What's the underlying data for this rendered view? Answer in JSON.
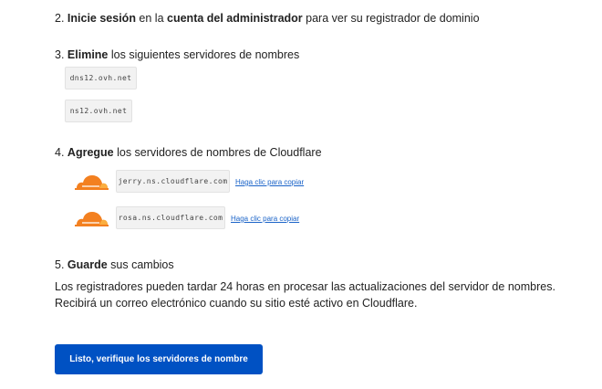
{
  "step2": {
    "num": "2.",
    "bold1": "Inicie sesión",
    "text1": " en la ",
    "bold2": "cuenta del administrador",
    "text2": " para ver su registrador de dominio"
  },
  "step3": {
    "num": "3.",
    "bold": "Elimine",
    "text": " los siguientes servidores de nombres",
    "nameservers": [
      "dns12.ovh.net",
      "ns12.ovh.net"
    ]
  },
  "step4": {
    "num": "4.",
    "bold": "Agregue",
    "text": " los servidores de nombres de Cloudflare",
    "nameservers": [
      {
        "value": "jerry.ns.cloudflare.com",
        "copy_label": "Haga clic para copiar"
      },
      {
        "value": "rosa.ns.cloudflare.com",
        "copy_label": "Haga clic para copiar"
      }
    ]
  },
  "step5": {
    "num": "5.",
    "bold": "Guarde",
    "text": " sus cambios",
    "note": "Los registradores pueden tardar 24 horas en procesar las actualizaciones del servidor de nombres. Recibirá un correo electrónico cuando su sitio esté activo en Cloudflare."
  },
  "cta": {
    "label": "Listo, verifique los servidores de nombre"
  },
  "colors": {
    "cloud_orange": "#f38020",
    "cloud_light": "#faae40",
    "button_blue": "#0051c3",
    "link_blue": "#1a63c8"
  },
  "icons": {
    "cloud": "cloudflare-cloud-icon"
  }
}
